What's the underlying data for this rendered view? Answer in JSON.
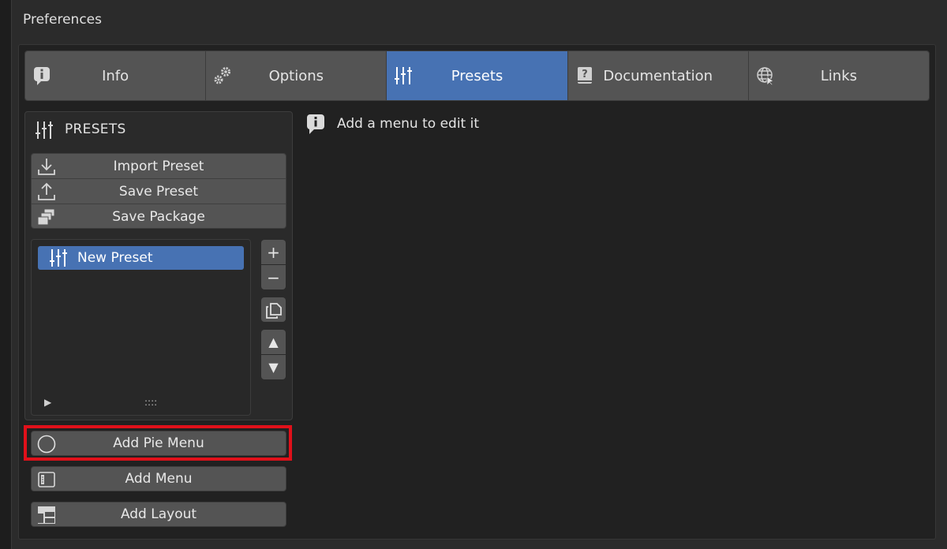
{
  "window": {
    "title": "Preferences"
  },
  "tabs": [
    {
      "label": "Info",
      "icon": "info-icon"
    },
    {
      "label": "Options",
      "icon": "gear-icon"
    },
    {
      "label": "Presets",
      "icon": "presets-icon",
      "active": true
    },
    {
      "label": "Documentation",
      "icon": "help-book-icon"
    },
    {
      "label": "Links",
      "icon": "globe-icon"
    }
  ],
  "presets_panel": {
    "header": "PRESETS",
    "actions": [
      {
        "label": "Import Preset",
        "icon": "import-icon"
      },
      {
        "label": "Save Preset",
        "icon": "export-icon"
      },
      {
        "label": "Save Package",
        "icon": "package-icon"
      }
    ],
    "list": {
      "items": [
        {
          "label": "New Preset",
          "icon": "presets-icon",
          "selected": true
        }
      ],
      "footer_arrow": "▶",
      "footer_grip": "::::"
    },
    "list_controls": {
      "add": "+",
      "remove": "−",
      "move_up": "▲",
      "move_down": "▼"
    },
    "add_buttons": [
      {
        "label": "Add Pie Menu",
        "icon": "circle-icon",
        "highlighted": true
      },
      {
        "label": "Add Menu",
        "icon": "menu-icon"
      },
      {
        "label": "Add Layout",
        "icon": "layout-icon"
      }
    ]
  },
  "main": {
    "message": "Add a menu to edit it",
    "message_icon": "info-icon"
  },
  "colors": {
    "accent": "#4772b3",
    "button": "#545454",
    "highlight": "#e0101a",
    "background": "#1d1d1d"
  }
}
